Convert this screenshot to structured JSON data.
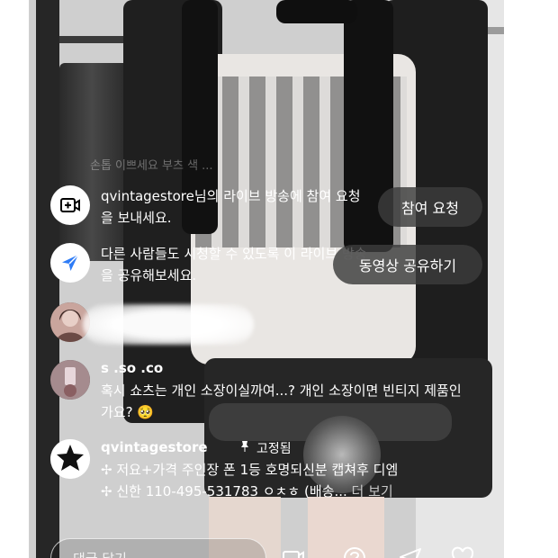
{
  "notifications": {
    "request": {
      "text": "qvintagestore님의 라이브 방송에 참여 요청을 보내세요.",
      "button": "참여 요청",
      "icon": "video-plus-icon"
    },
    "share": {
      "text": "다른 사람들도 시청할 수 있도록 이 라이브 방송을 공유해보세요.",
      "button": "동영상 공유하기",
      "icon": "send-icon"
    }
  },
  "faded_comment": "손톱 이쁘세요 부츠 색 ...",
  "comments": [
    {
      "user": "",
      "text": "",
      "avatar": "user-avatar-1"
    },
    {
      "user": "s .so .co",
      "text": "혹시 쇼츠는 개인 소장이실까여...? 개인 소장이면 빈티지 제품인가요? 🥺",
      "avatar": "user-avatar-2"
    },
    {
      "user": "qvintagestore",
      "pinned_label": "고정됨",
      "line1": "✢ 저요+가격 주인장 폰 1등 호명되신분 캡쳐후 디엠",
      "line2": "✢ 신한 110-495-531783 ㅇㅊㅎ (배송...",
      "more": "더 보기",
      "avatar": "store-avatar"
    }
  ],
  "comment_input": {
    "placeholder": "댓글 달기..."
  },
  "bottom_icons": [
    "add-media-icon",
    "question-icon",
    "send-icon",
    "heart-icon"
  ],
  "colors": {
    "overlay_button": "#3c3c3c",
    "text": "#ffffff"
  }
}
